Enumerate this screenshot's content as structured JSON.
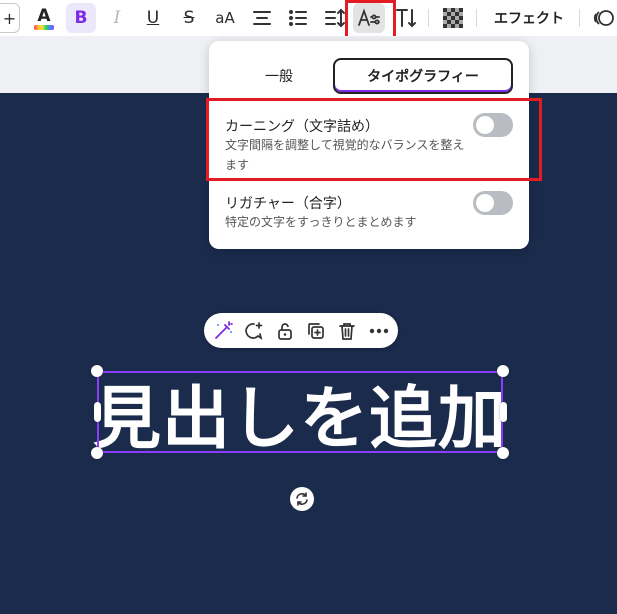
{
  "toolbar": {
    "plus": "+",
    "text_color_letter": "A",
    "bold": "B",
    "italic": "I",
    "underline": "U",
    "strikethrough": "S",
    "case": "aA",
    "effect_label": "エフェクト"
  },
  "panel": {
    "tabs": [
      {
        "label": "一般",
        "active": false
      },
      {
        "label": "タイポグラフィー",
        "active": true
      }
    ],
    "rows": [
      {
        "title": "カーニング（文字詰め）",
        "desc": "文字間隔を調整して視覚的なバランスを整えます",
        "enabled": false
      },
      {
        "title": "リガチャー（合字）",
        "desc": "特定の文字をすっきりとまとめます",
        "enabled": false
      }
    ]
  },
  "canvas": {
    "heading": "見出しを追加",
    "background": "#1a2b4c"
  },
  "colors": {
    "accent": "#7d2ae8",
    "selection": "#8b3dff",
    "highlight_box": "#e31c23"
  }
}
